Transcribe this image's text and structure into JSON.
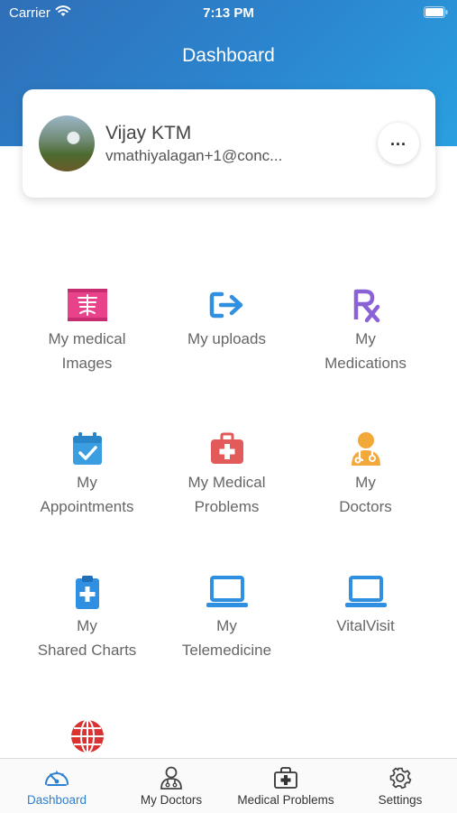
{
  "status_bar": {
    "carrier": "Carrier",
    "time": "7:13 PM"
  },
  "header": {
    "title": "Dashboard"
  },
  "profile": {
    "name": "Vijay KTM",
    "email": "vmathiyalagan+1@conc..."
  },
  "tiles": [
    {
      "line1": "My medical",
      "line2": "Images",
      "icon": "xray-icon",
      "color": "#e8438a"
    },
    {
      "line1": "My uploads",
      "line2": "",
      "icon": "upload-arrow-icon",
      "color": "#2f8fe0"
    },
    {
      "line1": "My",
      "line2": "Medications",
      "icon": "rx-icon",
      "color": "#8a62d6"
    },
    {
      "line1": "My",
      "line2": "Appointments",
      "icon": "calendar-check-icon",
      "color": "#3a9ee0"
    },
    {
      "line1": "My Medical",
      "line2": "Problems",
      "icon": "medical-kit-icon",
      "color": "#e25a5a"
    },
    {
      "line1": "My",
      "line2": "Doctors",
      "icon": "doctor-icon",
      "color": "#f3a83a"
    },
    {
      "line1": "My",
      "line2": "Shared Charts",
      "icon": "clipboard-plus-icon",
      "color": "#2f8fe0"
    },
    {
      "line1": "My",
      "line2": "Telemedicine",
      "icon": "laptop-icon",
      "color": "#2f8fe0"
    },
    {
      "line1": "VitalVisit",
      "line2": "",
      "icon": "laptop-icon",
      "color": "#2f8fe0"
    },
    {
      "line1": "",
      "line2": "",
      "icon": "globe-icon",
      "color": "#d83232"
    }
  ],
  "tab_bar": {
    "items": [
      {
        "label": "Dashboard",
        "icon": "speedometer-icon",
        "active": true
      },
      {
        "label": "My Doctors",
        "icon": "doctor-outline-icon",
        "active": false
      },
      {
        "label": "Medical Problems",
        "icon": "medical-kit-outline-icon",
        "active": false
      },
      {
        "label": "Settings",
        "icon": "gear-icon",
        "active": false
      }
    ],
    "active_color": "#2d7fcf"
  }
}
